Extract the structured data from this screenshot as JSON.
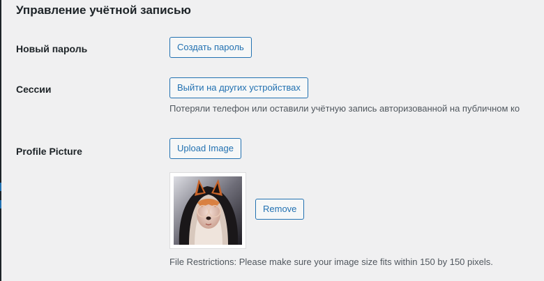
{
  "section": {
    "title": "Управление учётной записью"
  },
  "new_password": {
    "label": "Новый пароль",
    "button_label": "Создать пароль"
  },
  "sessions": {
    "label": "Сессии",
    "button_label": "Выйти на других устройствах",
    "description": "Потеряли телефон или оставили учётную запись авторизованной на публичном ко"
  },
  "profile_picture": {
    "label": "Profile Picture",
    "upload_button_label": "Upload Image",
    "remove_button_label": "Remove",
    "image": "profile-photo",
    "restrictions_text": "File Restrictions: Please make sure your image size fits within 150 by 150 pixels."
  },
  "colors": {
    "accent": "#2271b1",
    "background": "#f0f0f1",
    "text": "#1d2327",
    "muted_text": "#50575e"
  }
}
